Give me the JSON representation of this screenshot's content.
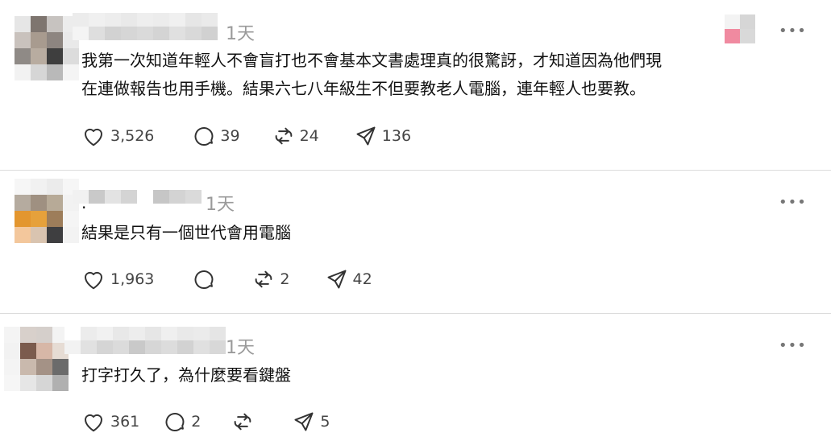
{
  "posts": [
    {
      "time": "1天",
      "more": "•••",
      "content": "我第一次知道年輕人不會盲打也不會基本文書處理真的很驚訝，才知道因為他們現\n在連做報告也用手機。結果六七八年級生不但要教老人電腦，連年輕人也要教。",
      "likes": "3,526",
      "comments": "39",
      "reposts": "24",
      "shares": "136"
    },
    {
      "time": "1天",
      "more": "•••",
      "dot": ".",
      "content": "結果是只有一個世代會用電腦",
      "likes": "1,963",
      "comments": "",
      "reposts": "2",
      "shares": "42"
    },
    {
      "time": "1天",
      "more": "•••",
      "content": "打字打久了，為什麼要看鍵盤",
      "likes": "361",
      "comments": "2",
      "reposts": "",
      "shares": "5"
    }
  ],
  "icons": {
    "like": "heart-icon",
    "comment": "comment-bubble-icon",
    "repost": "repost-icon",
    "share": "send-icon",
    "more": "more-options-icon"
  },
  "colors": {
    "text": "#111111",
    "muted": "#9a9a9a",
    "icon": "#444444",
    "divider": "#dcdcdc"
  }
}
